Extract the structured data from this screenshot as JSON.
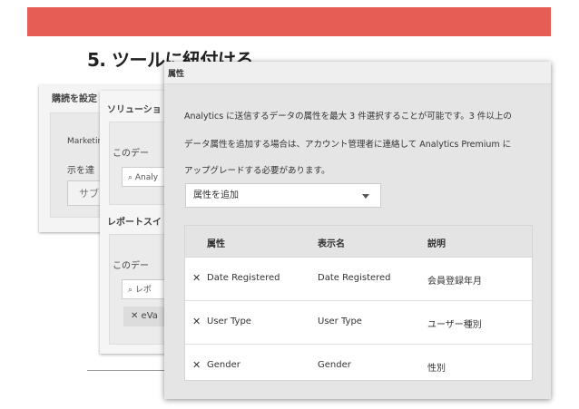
{
  "slide": {
    "title": "5. ツールに紐付ける"
  },
  "back_panel_1": {
    "title": "購読を設定",
    "text1": "Marketin",
    "text2": "示を達",
    "button": "サブ"
  },
  "back_panel_2": {
    "heading1": "ソリューショ",
    "text1": "このデー",
    "search1": "⌕ Analy",
    "heading2": "レポートスイ",
    "text2": "このデー",
    "search2": "⌕ レポ",
    "tag": "✕  eVa"
  },
  "dialog": {
    "title": "属性",
    "description_lines": [
      "Analytics に送信するデータの属性を最大 3 件選択することが可能です。3 件以上の",
      "データ属性を追加する場合は、アカウント管理者に連絡して Analytics Premium に",
      "アップグレードする必要があります。"
    ],
    "select_label": "属性を追加",
    "table": {
      "headers": [
        "属性",
        "表示名",
        "説明"
      ],
      "rows": [
        {
          "attribute": "Date Registered",
          "display_name": "Date Registered",
          "description": "会員登録年月"
        },
        {
          "attribute": "User Type",
          "display_name": "User Type",
          "description": "ユーザー種別"
        },
        {
          "attribute": "Gender",
          "display_name": "Gender",
          "description": "性別"
        }
      ],
      "remove_symbol": "✕"
    }
  },
  "colors": {
    "banner": "#e55d55"
  }
}
